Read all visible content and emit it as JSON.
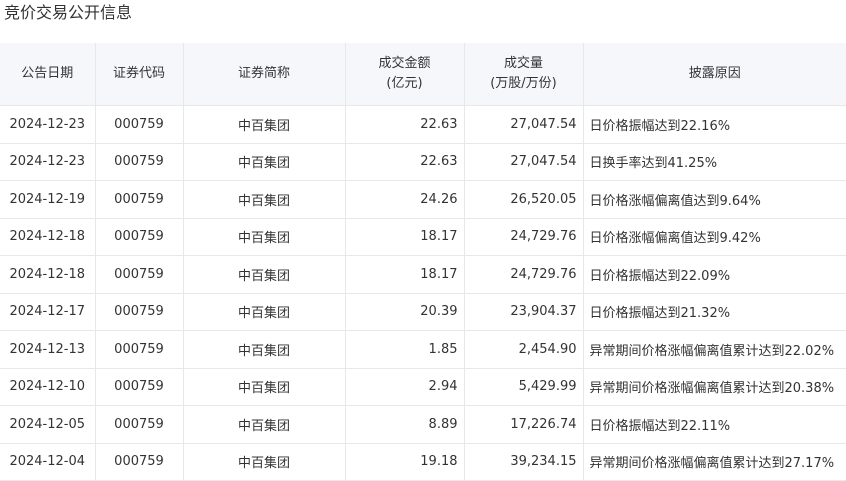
{
  "page": {
    "title": "竞价交易公开信息"
  },
  "table": {
    "headers": {
      "date": "公告日期",
      "code": "证券代码",
      "name": "证券简称",
      "amount_line1": "成交金额",
      "amount_line2": "(亿元)",
      "volume_line1": "成交量",
      "volume_line2": "(万股/万份)",
      "reason": "披露原因"
    },
    "rows": [
      {
        "date": "2024-12-23",
        "code": "000759",
        "name": "中百集团",
        "amount": "22.63",
        "volume": "27,047.54",
        "reason": "日价格振幅达到22.16%"
      },
      {
        "date": "2024-12-23",
        "code": "000759",
        "name": "中百集团",
        "amount": "22.63",
        "volume": "27,047.54",
        "reason": "日换手率达到41.25%"
      },
      {
        "date": "2024-12-19",
        "code": "000759",
        "name": "中百集团",
        "amount": "24.26",
        "volume": "26,520.05",
        "reason": "日价格涨幅偏离值达到9.64%"
      },
      {
        "date": "2024-12-18",
        "code": "000759",
        "name": "中百集团",
        "amount": "18.17",
        "volume": "24,729.76",
        "reason": "日价格涨幅偏离值达到9.42%"
      },
      {
        "date": "2024-12-18",
        "code": "000759",
        "name": "中百集团",
        "amount": "18.17",
        "volume": "24,729.76",
        "reason": "日价格振幅达到22.09%"
      },
      {
        "date": "2024-12-17",
        "code": "000759",
        "name": "中百集团",
        "amount": "20.39",
        "volume": "23,904.37",
        "reason": "日价格振幅达到21.32%"
      },
      {
        "date": "2024-12-13",
        "code": "000759",
        "name": "中百集团",
        "amount": "1.85",
        "volume": "2,454.90",
        "reason": "异常期间价格涨幅偏离值累计达到22.02%"
      },
      {
        "date": "2024-12-10",
        "code": "000759",
        "name": "中百集团",
        "amount": "2.94",
        "volume": "5,429.99",
        "reason": "异常期间价格涨幅偏离值累计达到20.38%"
      },
      {
        "date": "2024-12-05",
        "code": "000759",
        "name": "中百集团",
        "amount": "8.89",
        "volume": "17,226.74",
        "reason": "日价格振幅达到22.11%"
      },
      {
        "date": "2024-12-04",
        "code": "000759",
        "name": "中百集团",
        "amount": "19.18",
        "volume": "39,234.15",
        "reason": "异常期间价格涨幅偏离值累计达到27.17%"
      }
    ]
  }
}
